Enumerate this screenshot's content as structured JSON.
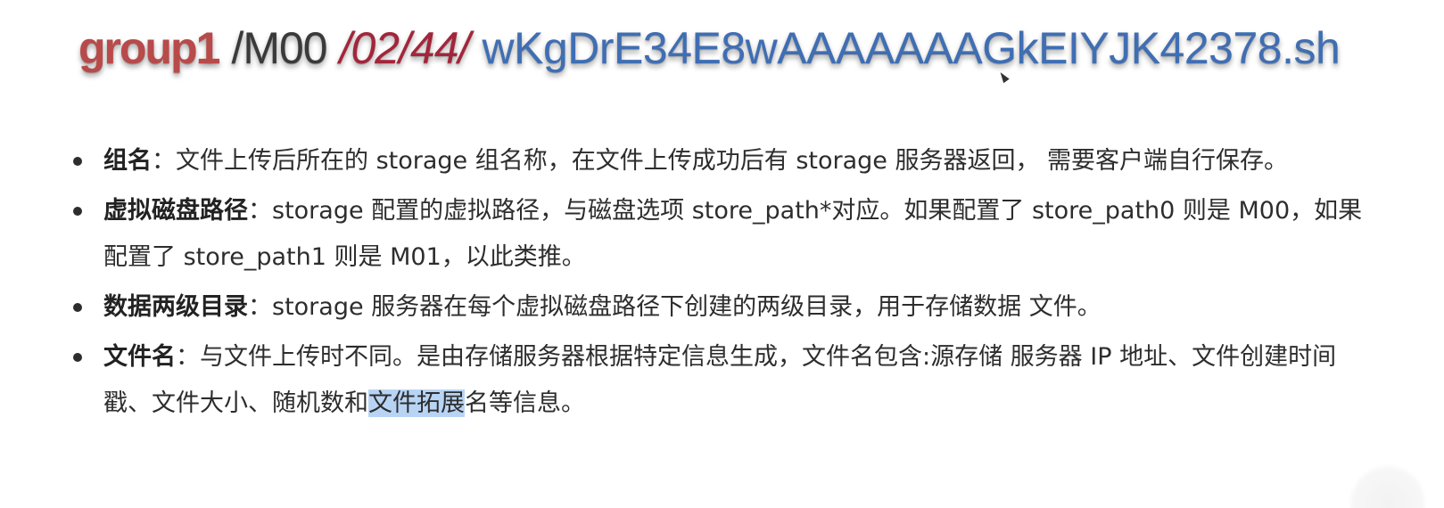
{
  "banner": {
    "group": "group1",
    "disk": "/M00",
    "dirs": "/02/44/",
    "file": "wKgDrE34E8wAAAAAAAGkEIYJK42378.sh"
  },
  "items": [
    {
      "term": "组名",
      "text": "：文件上传后所在的 storage 组名称，在文件上传成功后有 storage 服务器返回， 需要客户端自行保存。"
    },
    {
      "term": "虚拟磁盘路径",
      "text": "：storage 配置的虚拟路径，与磁盘选项 store_path*对应。如果配置了 store_path0 则是 M00，如果配置了 store_path1 则是 M01，以此类推。"
    },
    {
      "term": "数据两级目录",
      "text": "：storage 服务器在每个虚拟磁盘路径下创建的两级目录，用于存储数据 文件。"
    },
    {
      "term": "文件名",
      "text_before": "：与文件上传时不同。是由存储服务器根据特定信息生成，文件名包含:源存储 服务器 IP 地址、文件创建时间戳、文件大小、随机数和",
      "highlight": "文件拓展",
      "text_after": "名等信息。"
    }
  ]
}
